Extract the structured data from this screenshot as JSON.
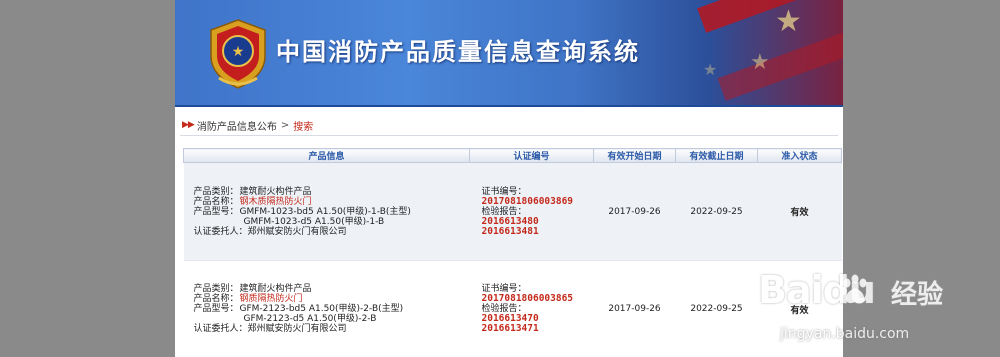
{
  "header": {
    "title": "中国消防产品质量信息查询系统"
  },
  "breadcrumb": {
    "root": "消防产品信息公布",
    "separator": ">",
    "current": "搜索"
  },
  "table": {
    "columns": [
      "产品信息",
      "认证编号",
      "有效开始日期",
      "有效截止日期",
      "准入状态"
    ],
    "labels": {
      "category": "产品类别：",
      "name": "产品名称：",
      "model": "产品型号：",
      "client": "认证委托人：",
      "cert_no": "证书编号：",
      "report": "检验报告："
    },
    "rows": [
      {
        "category": "建筑耐火构件产品",
        "name": "钢木质隔热防火门",
        "model_1": "GMFM-1023-bd5 A1.50(甲级)-1-B(主型)",
        "model_2": "GMFM-1023-d5 A1.50(甲级)-1-B",
        "client": "郑州赋安防火门有限公司",
        "cert_no": "2017081806003869",
        "report_1": "2016613480",
        "report_2": "2016613481",
        "start": "2017-09-26",
        "end": "2022-09-25",
        "status": "有效"
      },
      {
        "category": "建筑耐火构件产品",
        "name": "钢质隔热防火门",
        "model_1": "GFM-2123-bd5 A1.50(甲级)-2-B(主型)",
        "model_2": "GFM-2123-d5 A1.50(甲级)-2-B",
        "client": "郑州赋安防火门有限公司",
        "cert_no": "2017081806003865",
        "report_1": "2016613470",
        "report_2": "2016613471",
        "start": "2017-09-26",
        "end": "2022-09-25",
        "status": "有效"
      }
    ]
  },
  "watermark": {
    "logo": "Baidu",
    "cn": "经验",
    "url": "jingyan.baidu.com"
  },
  "colors": {
    "accent_red": "#c42a1c",
    "valid_green": "#2d8a22",
    "header_blue": "#2c5aa8"
  }
}
